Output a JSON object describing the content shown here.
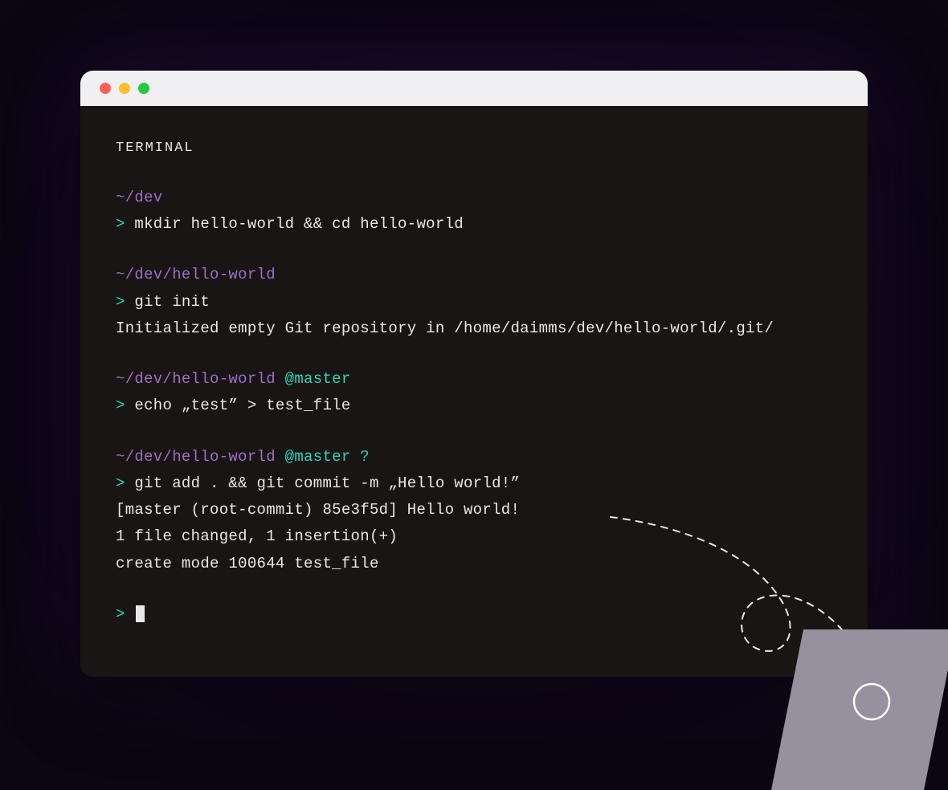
{
  "terminal": {
    "title": "TERMINAL",
    "blocks": [
      {
        "path": "~/dev",
        "branch": "",
        "status": "",
        "command": "mkdir hello-world && cd hello-world",
        "output": []
      },
      {
        "path": "~/dev/hello-world",
        "branch": "",
        "status": "",
        "command": "git init",
        "output": [
          "Initialized empty Git repository in /home/daimms/dev/hello-world/.git/"
        ]
      },
      {
        "path": "~/dev/hello-world",
        "branch": "@master",
        "status": "",
        "command": "echo „test” > test_file",
        "output": []
      },
      {
        "path": "~/dev/hello-world",
        "branch": "@master",
        "status": "?",
        "command": "git add . && git commit -m „Hello world!”",
        "output": [
          "[master (root-commit) 85e3f5d] Hello world!",
          "1 file changed, 1 insertion(+)",
          "create mode 100644 test_file"
        ]
      }
    ],
    "prompt_symbol": ">",
    "colors": {
      "path": "#9b6fc4",
      "branch": "#2fd4b8",
      "prompt": "#2fd4b8",
      "text": "#e8e8e8"
    },
    "window_controls": [
      "close",
      "minimize",
      "maximize"
    ]
  }
}
